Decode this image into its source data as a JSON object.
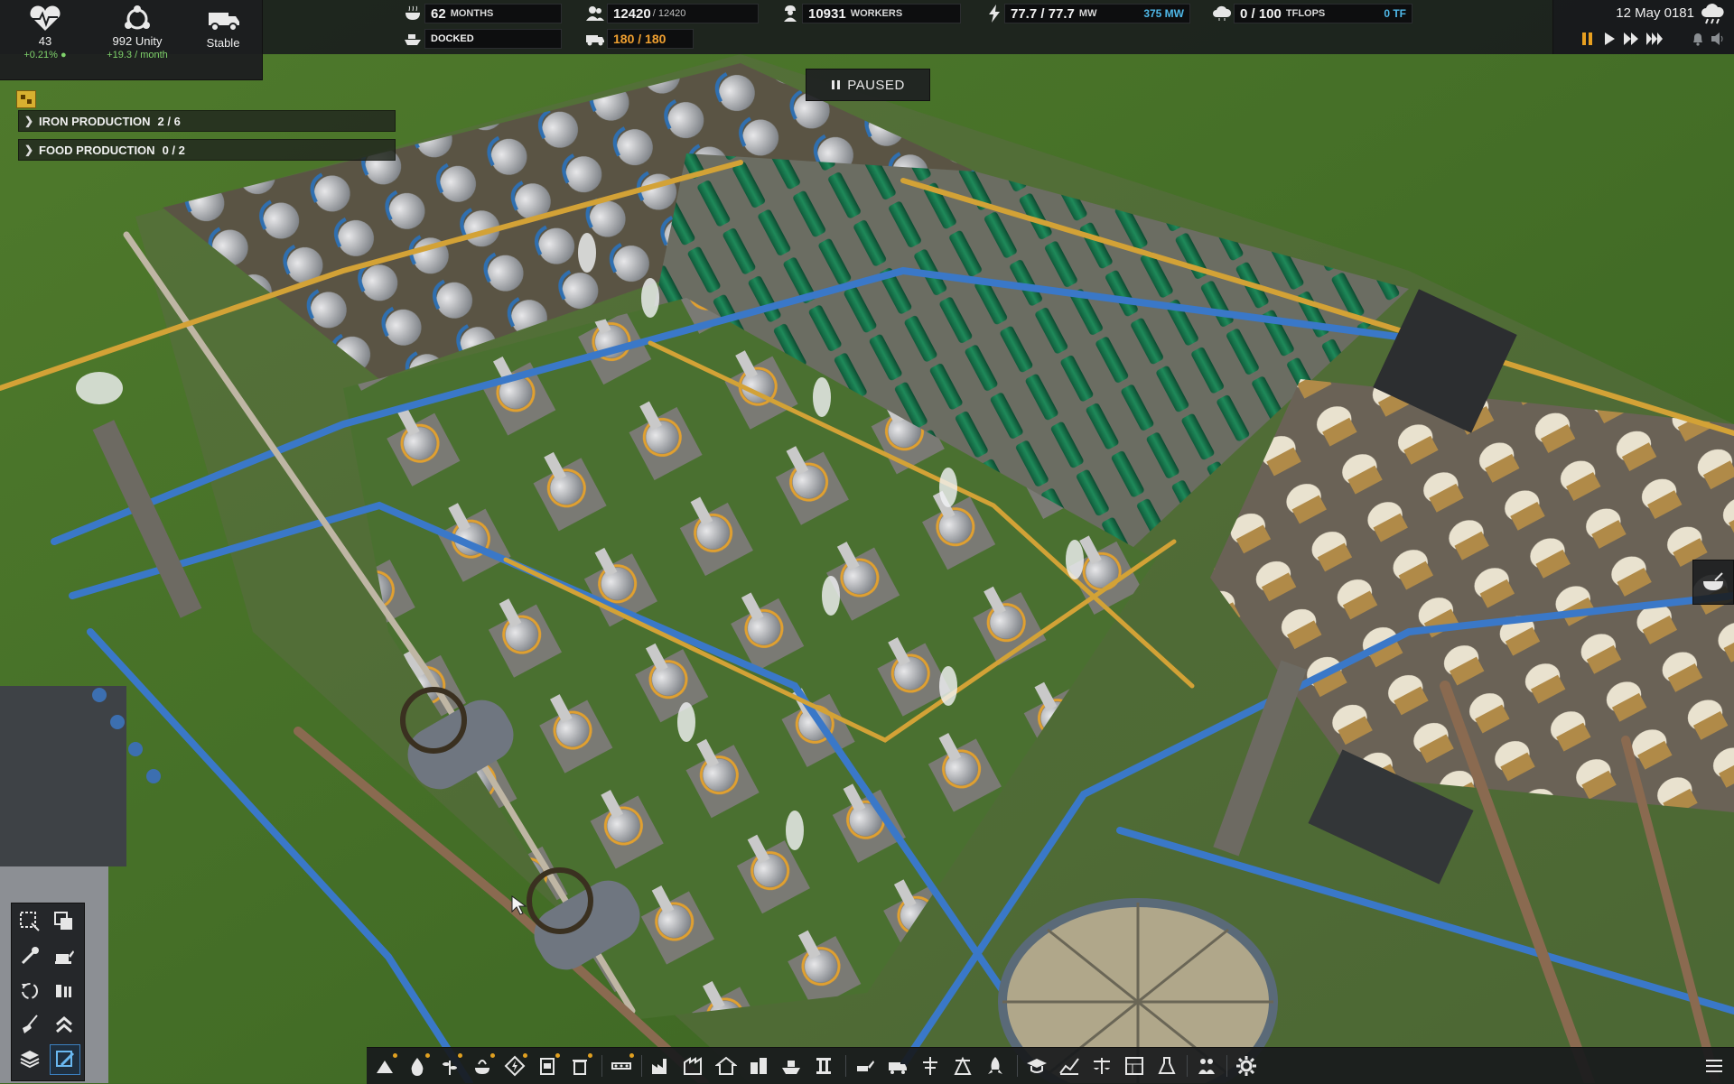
{
  "stats": {
    "health": {
      "value": "43",
      "delta": "+0.21%"
    },
    "unity": {
      "value": "992 Unity",
      "delta": "+19.3 / month"
    },
    "trucks": {
      "status": "Stable"
    }
  },
  "resources": {
    "months": {
      "value": "62",
      "unit": "MONTHS"
    },
    "population": {
      "value": "12420",
      "sub": "/ 12420"
    },
    "workers": {
      "value": "10931",
      "unit": "WORKERS"
    },
    "power": {
      "value": "77.7 / 77.7",
      "unit": "MW",
      "accent": "375 MW"
    },
    "compute": {
      "value": "0 / 100",
      "unit": "TFLOPS",
      "accent": "0 TF"
    },
    "ship": {
      "status": "DOCKED"
    },
    "vehicles": {
      "value": "180 / 180"
    }
  },
  "date": "12 May 0181",
  "paused_label": "PAUSED",
  "quests": [
    {
      "label": "IRON PRODUCTION",
      "count": "2 / 6"
    },
    {
      "label": "FOOD PRODUCTION",
      "count": "0 / 2"
    }
  ],
  "colors": {
    "accent_blue": "#4fb8e8",
    "positive_green": "#7fd36b",
    "vehicles_orange": "#f0a030",
    "grass": "#3f6a24"
  },
  "icons": {
    "health": "heart-icon",
    "unity": "unity-icon",
    "trucks": "truck-icon",
    "months": "food-bowl-icon",
    "population": "people-icon",
    "workers": "worker-icon",
    "power": "lightning-icon",
    "compute": "cloud-compute-icon",
    "ship": "ship-icon",
    "vehicles": "vehicle-icon"
  }
}
